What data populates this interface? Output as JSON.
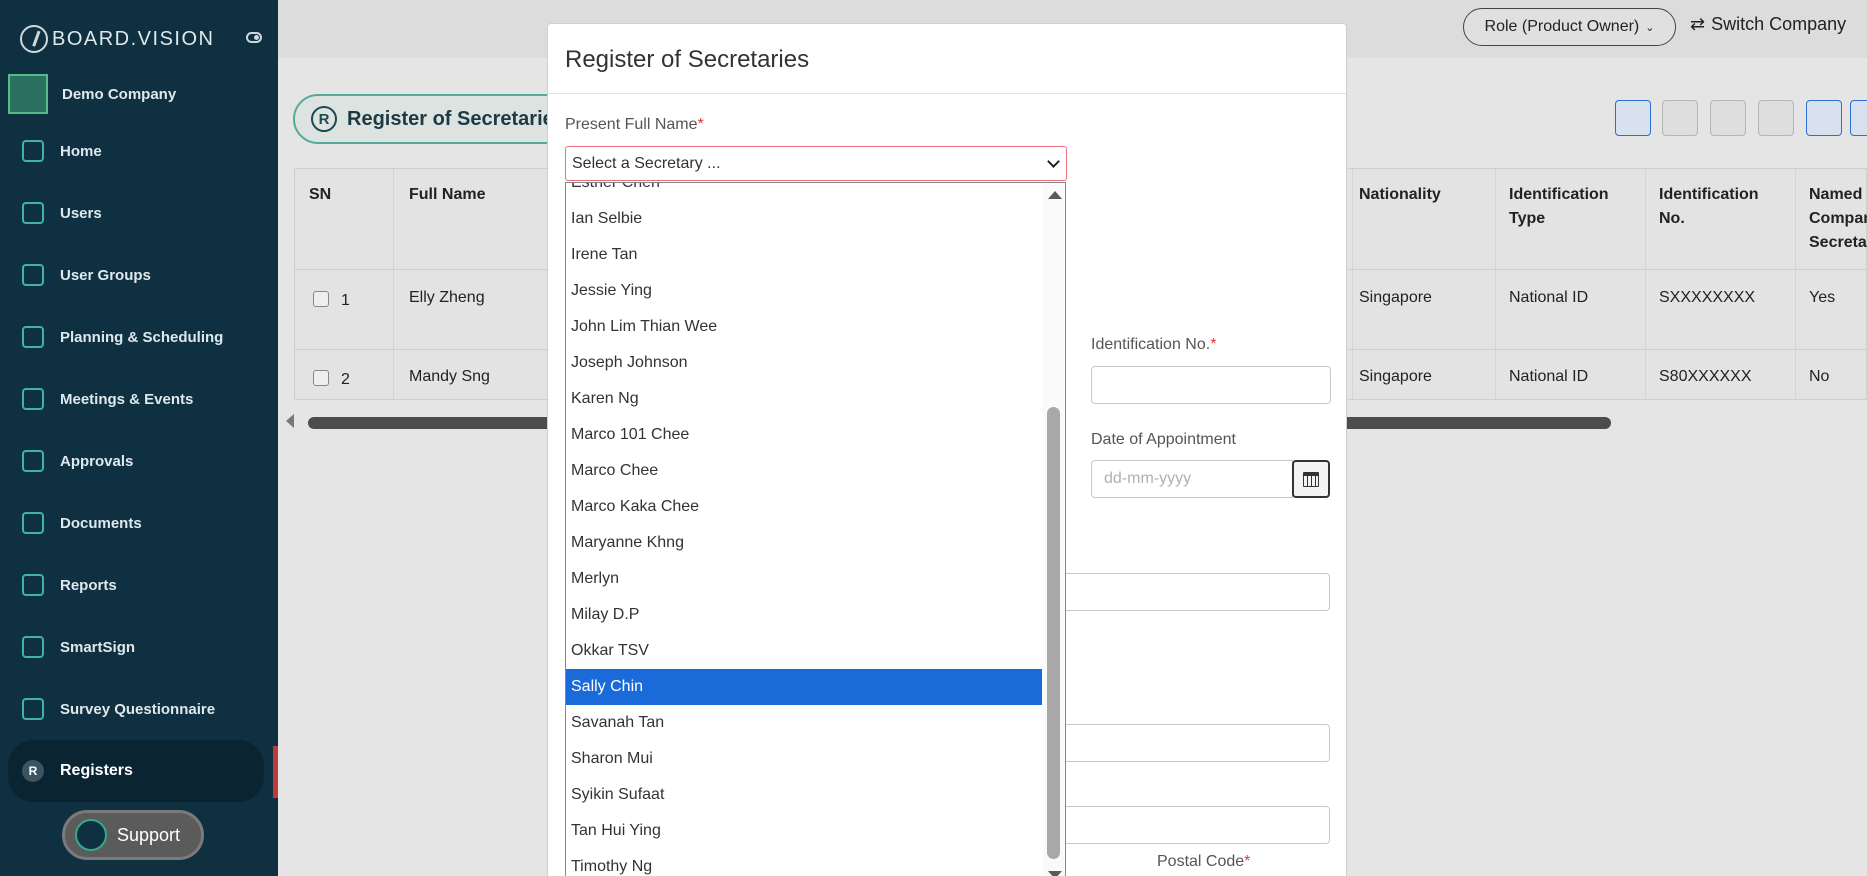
{
  "brand": {
    "name": "BOARD.VISION"
  },
  "company": {
    "name": "Demo Company"
  },
  "sidebar": {
    "items": [
      {
        "label": "Home"
      },
      {
        "label": "Users"
      },
      {
        "label": "User Groups"
      },
      {
        "label": "Planning & Scheduling"
      },
      {
        "label": "Meetings & Events"
      },
      {
        "label": "Approvals"
      },
      {
        "label": "Documents"
      },
      {
        "label": "Reports"
      },
      {
        "label": "SmartSign"
      },
      {
        "label": "Survey Questionnaire"
      },
      {
        "label": "Registers",
        "icon_letter": "R"
      }
    ],
    "support_label": "Support"
  },
  "topbar": {
    "role_label": "Role (Product Owner)",
    "switch_company_label": "Switch Company"
  },
  "page": {
    "title": "Register of Secretarie",
    "title_icon_letter": "R"
  },
  "table": {
    "headers": {
      "sn": "SN",
      "full_name": "Full Name",
      "nationality": "Nationality",
      "id_type_1": "Identification",
      "id_type_2": "Type",
      "id_no_1": "Identification",
      "id_no_2": "No.",
      "named_1": "Named",
      "named_2": "Compan",
      "named_3": "Secreta"
    },
    "rows": [
      {
        "sn": "1",
        "name": "Elly Zheng",
        "nationality": "Singapore",
        "id_type": "National ID",
        "id_no": "SXXXXXXXX",
        "named": "Yes"
      },
      {
        "sn": "2",
        "name": "Mandy Sng",
        "nationality": "Singapore",
        "id_type": "National ID",
        "id_no": "S80XXXXXX",
        "named": "No"
      }
    ]
  },
  "modal": {
    "title": "Register of Secretaries",
    "present_full_name_label": "Present Full Name",
    "required_mark": "*",
    "select_placeholder": "Select a Secretary ...",
    "identification_no_label": "Identification No.",
    "date_of_appointment_label": "Date of Appointment",
    "date_placeholder": "dd-mm-yyyy",
    "postal_code_label": "Postal Code"
  },
  "dropdown": {
    "selected": "Sally Chin",
    "options": [
      "Esther Chen",
      "Ian Selbie",
      "Irene Tan",
      "Jessie Ying",
      "John Lim Thian Wee",
      "Joseph Johnson",
      "Karen Ng",
      "Marco 101 Chee",
      "Marco Chee",
      "Marco Kaka Chee",
      "Maryanne Khng",
      "Merlyn",
      "Milay D.P",
      "Okkar TSV",
      "Sally Chin",
      "Savanah Tan",
      "Sharon Mui",
      "Syikin Sufaat",
      "Tan Hui Ying",
      "Timothy Ng"
    ]
  },
  "colors": {
    "sidebar_bg": "#0e3040",
    "accent_teal": "#3fb3a5",
    "selected_blue": "#1a6ad9",
    "required_red": "#e03a3e"
  }
}
